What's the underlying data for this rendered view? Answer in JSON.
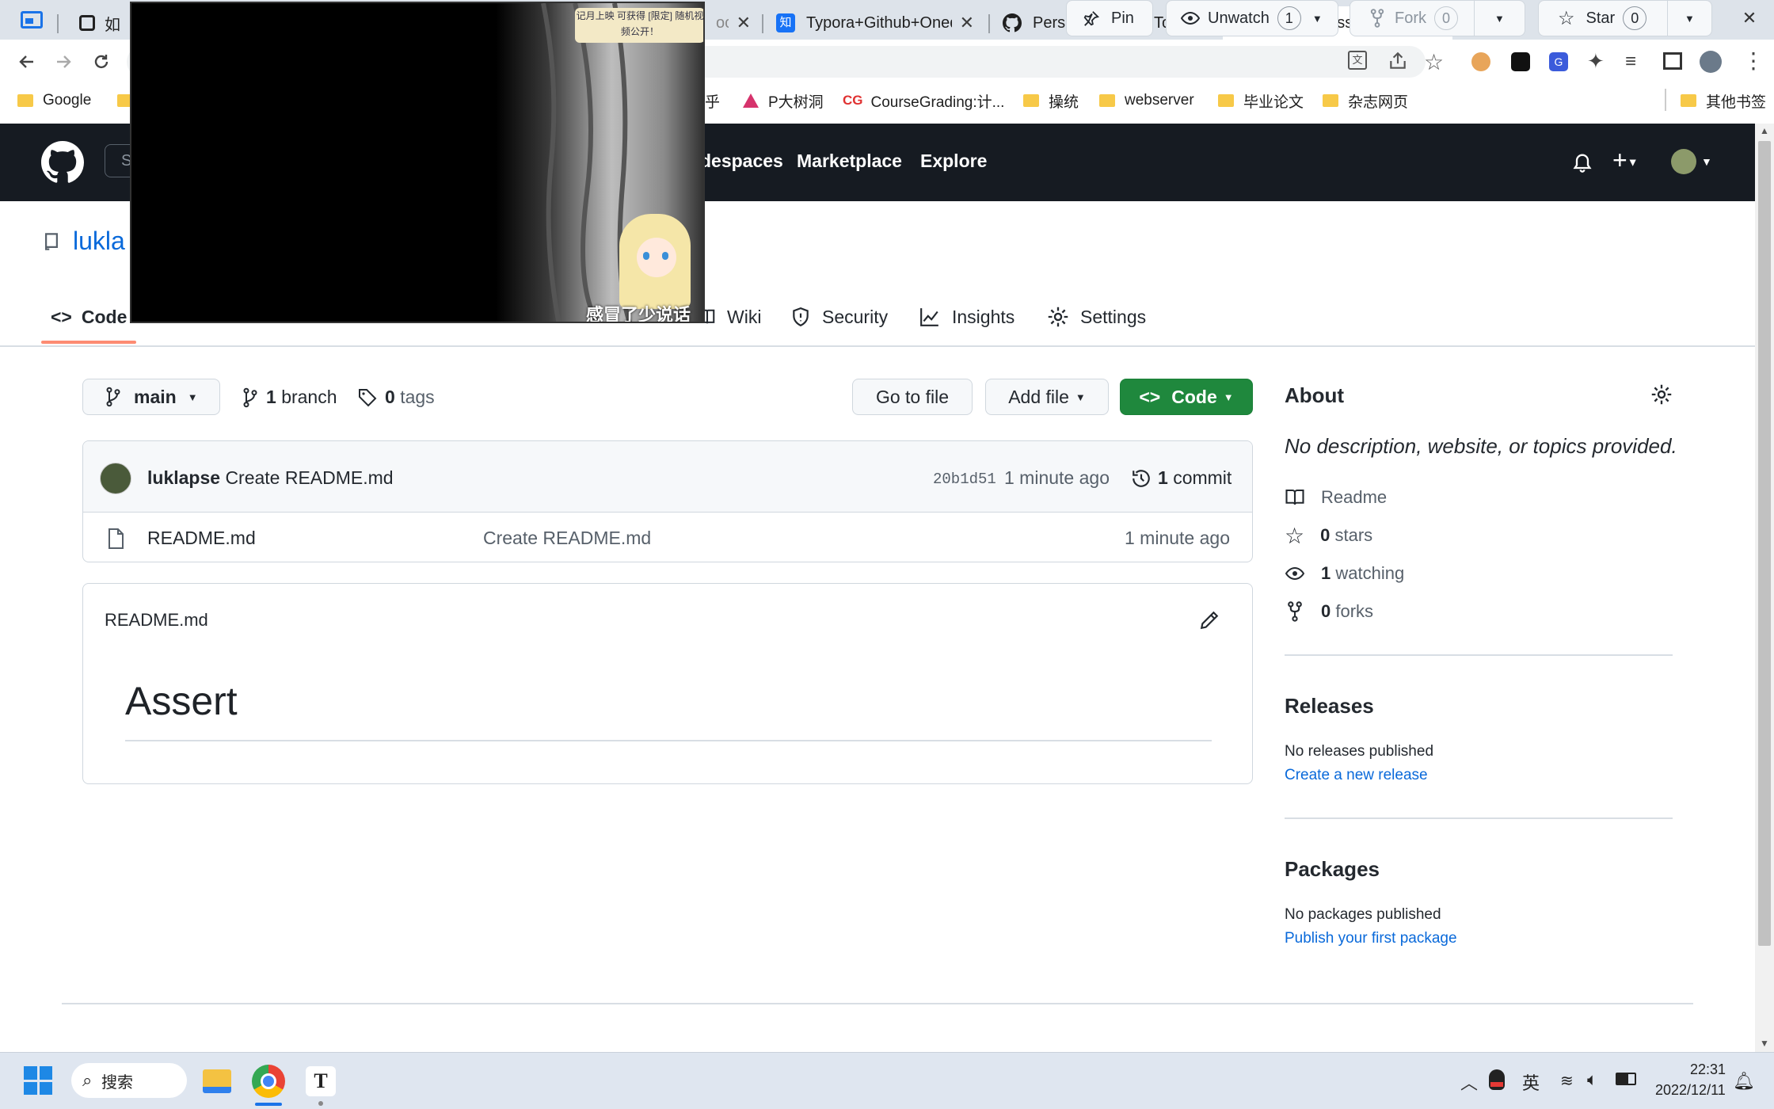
{
  "browser": {
    "tabs": [
      {
        "title": "如何",
        "icon": "doc-icon"
      },
      {
        "title": "Typora+Github+Onedr",
        "icon": "zhihu-icon"
      },
      {
        "title": "Personal Access Tokens",
        "icon": "github-icon"
      },
      {
        "title": "luklapse/Assert",
        "icon": "github-icon",
        "active": true
      }
    ],
    "partial_tab_text": "oc",
    "bookmarks": [
      "Google",
      "乎",
      "P大树洞",
      "CourseGrading:计...",
      "操统",
      "webserver",
      "毕业论文",
      "杂志网页",
      "其他书签"
    ]
  },
  "github": {
    "search_placeholder_fragment": "S",
    "nav": [
      "despaces",
      "Marketplace",
      "Explore"
    ],
    "repo_owner_fragment": "lukla",
    "buttons": {
      "pin": "Pin",
      "unwatch": "Unwatch",
      "unwatch_count": "1",
      "fork": "Fork",
      "fork_count": "0",
      "star": "Star",
      "star_count": "0"
    },
    "tabs": {
      "code": "Code",
      "wiki": "Wiki",
      "security": "Security",
      "insights": "Insights",
      "settings": "Settings"
    },
    "branch_selector": "main",
    "branch_count": "1",
    "branch_word": "branch",
    "tag_count": "0",
    "tag_word": "tags",
    "go_to_file": "Go to file",
    "add_file": "Add file",
    "code_button": "Code",
    "commit": {
      "author": "luklapse",
      "message": "Create README.md",
      "hash": "20b1d51",
      "time": "1 minute ago",
      "count": "1",
      "count_word": "commit"
    },
    "files": [
      {
        "name": "README.md",
        "message": "Create README.md",
        "time": "1 minute ago"
      }
    ],
    "readme": {
      "filename": "README.md",
      "heading": "Assert"
    },
    "about": {
      "title": "About",
      "description": "No description, website, or topics provided.",
      "readme": "Readme",
      "stars_count": "0",
      "stars_word": "stars",
      "watching_count": "1",
      "watching_word": "watching",
      "forks_count": "0",
      "forks_word": "forks"
    },
    "releases": {
      "title": "Releases",
      "text": "No releases published",
      "link": "Create a new release"
    },
    "packages": {
      "title": "Packages",
      "text": "No packages published",
      "link": "Publish your first package"
    }
  },
  "video_overlay": {
    "caption": "感冒了少说话",
    "banner": "记月上映 可获得 [限定] 随机视频公开！"
  },
  "taskbar": {
    "search": "搜索",
    "ime": "英",
    "time": "22:31",
    "date": "2022/12/11"
  }
}
